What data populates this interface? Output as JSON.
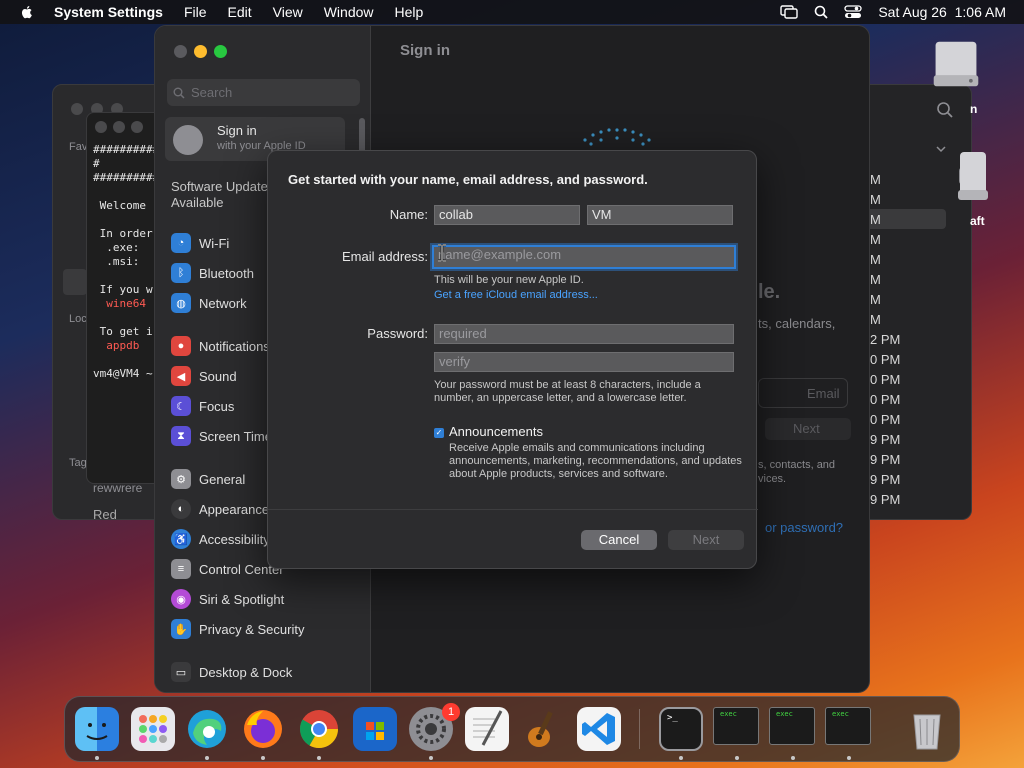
{
  "menubar": {
    "app_name": "System Settings",
    "menus": [
      "File",
      "Edit",
      "View",
      "Window",
      "Help"
    ],
    "datetime": "Sat Aug 26  1:06 AM"
  },
  "terminal": {
    "lines": [
      "##########",
      "#",
      "##########",
      "",
      " Welcome",
      "",
      " In order",
      "  .exe:",
      "  .msi:",
      "",
      " If you w",
      "  wine64",
      "",
      " To get i",
      "  appdb",
      "",
      "vm4@VM4 ~"
    ]
  },
  "back_window": {
    "side_labels": [
      "Fav",
      "Loc",
      "Tag"
    ],
    "bottom_text": "Red",
    "bottom_text_2": "rewwrere"
  },
  "right_window": {
    "times": [
      "M",
      "M",
      "M",
      "M",
      "M",
      "M",
      "M",
      "M",
      "2 PM",
      "0 PM",
      "0 PM",
      "0 PM",
      "0 PM",
      "9 PM",
      "9 PM",
      "9 PM",
      "9 PM"
    ]
  },
  "desktop": {
    "disk1_label": "n",
    "disk2_label": "aft"
  },
  "settings": {
    "pane_title": "Sign in",
    "search_placeholder": "Search",
    "signin_title": "Sign in",
    "signin_sub": "with your Apple ID",
    "software_update": "Software Update Available",
    "items": [
      {
        "label": "Wi-Fi",
        "icon": "wifi-icon",
        "color": "#2f7fd6"
      },
      {
        "label": "Bluetooth",
        "icon": "bluetooth-icon",
        "color": "#2f7fd6"
      },
      {
        "label": "Network",
        "icon": "globe-icon",
        "color": "#2f7fd6"
      },
      {
        "label": "Notifications",
        "icon": "bell-icon",
        "color": "#e0463e"
      },
      {
        "label": "Sound",
        "icon": "speaker-icon",
        "color": "#e0463e"
      },
      {
        "label": "Focus",
        "icon": "moon-icon",
        "color": "#5b4fd6"
      },
      {
        "label": "Screen Time",
        "icon": "hourglass-icon",
        "color": "#5b4fd6"
      },
      {
        "label": "General",
        "icon": "gear-icon",
        "color": "#8e8e93"
      },
      {
        "label": "Appearance",
        "icon": "appearance-icon",
        "color": "#3a3a3c"
      },
      {
        "label": "Accessibility",
        "icon": "accessibility-icon",
        "color": "#2f7fd6"
      },
      {
        "label": "Control Center",
        "icon": "control-center-icon",
        "color": "#8e8e93"
      },
      {
        "label": "Siri & Spotlight",
        "icon": "siri-icon",
        "color": "#b44bd6"
      },
      {
        "label": "Privacy & Security",
        "icon": "hand-icon",
        "color": "#2f7fd6"
      },
      {
        "label": "Desktop & Dock",
        "icon": "dock-icon",
        "color": "#3a3a3c"
      }
    ],
    "faint": {
      "headline_tail": "le.",
      "line2": "ts, calendars,",
      "email_btn": "Email",
      "next_btn": "Next",
      "line3": "s, contacts, and",
      "line4": "vices.",
      "forgot": "or password?"
    }
  },
  "dialog": {
    "title": "Get started with your name, email address, and password.",
    "name_label": "Name:",
    "first_name": "collab",
    "last_name": "VM",
    "email_label": "Email address:",
    "email_placeholder": "name@example.com",
    "email_hint": "This will be your new Apple ID.",
    "icloud_link": "Get a free iCloud email address...",
    "password_label": "Password:",
    "password_placeholder": "required",
    "verify_placeholder": "verify",
    "password_hint": "Your password must be at least 8 characters, include a number, an uppercase letter, and a lowercase letter.",
    "announcements_label": "Announcements",
    "announcements_checked": true,
    "announcements_desc": "Receive Apple emails and communications including announcements, marketing, recommendations, and updates about Apple products, services and software.",
    "cancel": "Cancel",
    "next": "Next"
  },
  "dock": {
    "apps": [
      "finder-icon",
      "launchpad-icon",
      "edge-icon",
      "firefox-icon",
      "chrome-icon",
      "microsoft-store-icon",
      "system-settings-icon",
      "textedit-icon",
      "garageband-icon",
      "vscode-icon",
      "terminal-icon",
      "exec-icon",
      "exec-icon",
      "exec-icon",
      "trash-icon"
    ],
    "settings_badge": "1",
    "exec_label": "exec",
    "terminal_prompt": ">_"
  }
}
